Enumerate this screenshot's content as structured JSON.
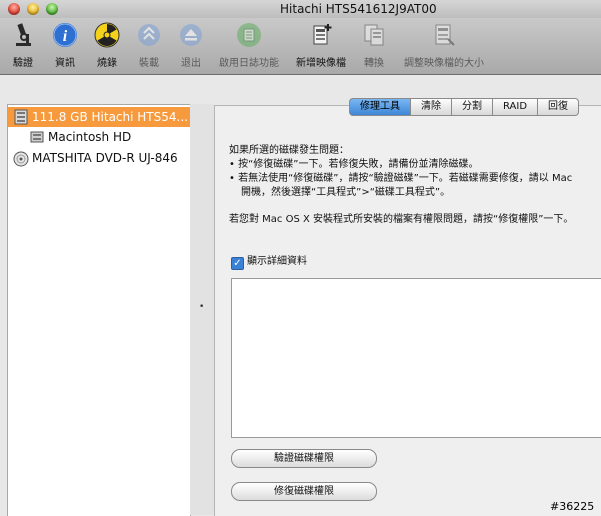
{
  "window": {
    "title": "Hitachi HTS541612J9AT00"
  },
  "toolbar": {
    "items": [
      {
        "label": "驗證",
        "icon": "microscope-icon"
      },
      {
        "label": "資訊",
        "icon": "info-icon"
      },
      {
        "label": "燒錄",
        "icon": "burn-icon"
      },
      {
        "label": "裝載",
        "icon": "mount-icon"
      },
      {
        "label": "退出",
        "icon": "eject-icon"
      },
      {
        "label": "啟用日誌功能",
        "icon": "journal-icon"
      },
      {
        "label": "新增映像檔",
        "icon": "new-image-icon"
      },
      {
        "label": "轉換",
        "icon": "convert-icon"
      },
      {
        "label": "調整映像檔的大小",
        "icon": "resize-image-icon"
      }
    ]
  },
  "sidebar": {
    "items": [
      {
        "label": "111.8 GB Hitachi HTS54...",
        "icon": "hard-disk-icon"
      },
      {
        "label": "Macintosh HD",
        "icon": "volume-icon"
      },
      {
        "label": "MATSHITA DVD-R UJ-846",
        "icon": "optical-drive-icon"
      }
    ]
  },
  "tabs": [
    "修理工具",
    "清除",
    "分割",
    "RAID",
    "回復"
  ],
  "content": {
    "intro": "如果所選的磁碟發生問題：",
    "bullet1": "• 按“修復磁碟”一下。若修復失敗，請備份並清除磁碟。",
    "bullet2a": "• 若無法使用“修復磁碟”，請按“驗證磁碟”一下。若磁碟需要修復，請以 Mac",
    "bullet2b": "開機，然後選擇“工具程式”>“磁碟工具程式”。",
    "permissions_note": "若您對 Mac OS X 安裝程式所安裝的檔案有權限問題，請按“修復權限”一下。",
    "show_details_label": "顯示詳細資料",
    "verify_permissions_button": "驗證磁碟權限",
    "repair_permissions_button": "修復磁碟權限"
  },
  "watermark": "#36225"
}
